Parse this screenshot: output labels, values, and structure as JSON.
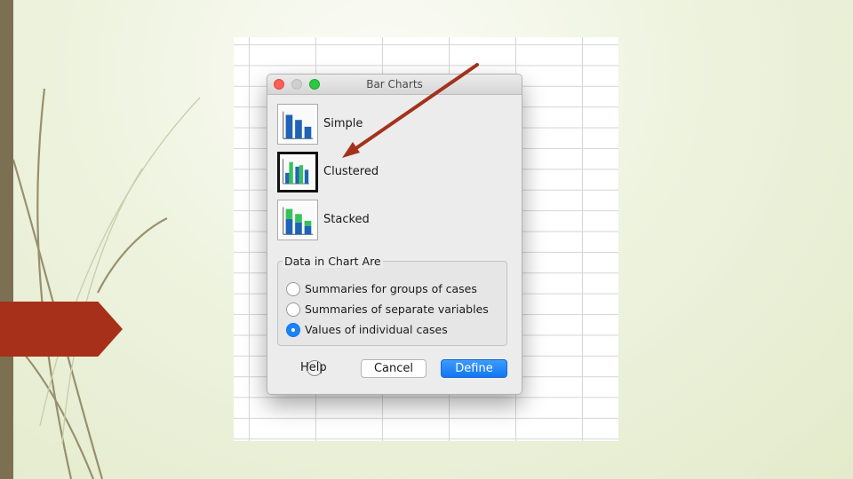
{
  "dialog": {
    "title": "Bar Charts",
    "chart_types": [
      {
        "label": "Simple",
        "selected": false
      },
      {
        "label": "Clustered",
        "selected": true
      },
      {
        "label": "Stacked",
        "selected": false
      }
    ],
    "group_title": "Data in Chart Are",
    "options": [
      {
        "label": "Summaries for groups of cases",
        "checked": false
      },
      {
        "label": "Summaries of separate variables",
        "checked": false
      },
      {
        "label": "Values of individual cases",
        "checked": true
      }
    ],
    "help_label": "Help",
    "cancel_label": "Cancel",
    "define_label": "Define"
  },
  "colors": {
    "accent_blue": "#1a82fb",
    "bar_blue": "#1f63b7",
    "bar_green": "#36c25a",
    "arrow": "#a3321c",
    "slide_tab": "#a7301a"
  },
  "icons": [
    "close-icon",
    "minimize-icon",
    "zoom-icon",
    "help-icon",
    "radio-selected-icon"
  ]
}
